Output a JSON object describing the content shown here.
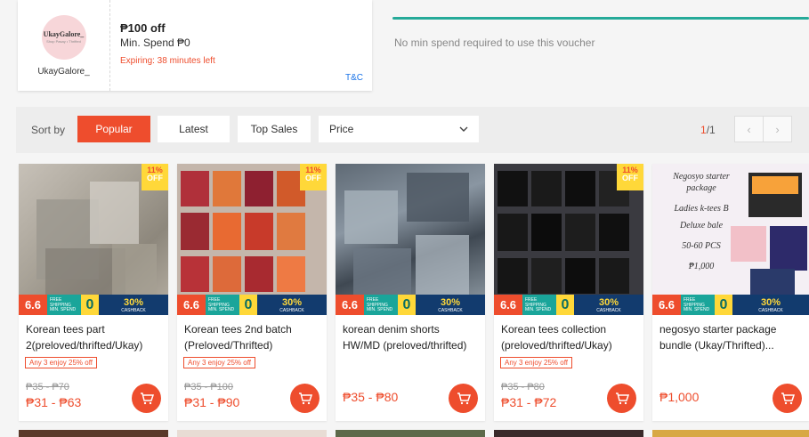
{
  "voucher": {
    "shop_logo_text": "UkayGalore_",
    "shop_logo_sub": "Shop Pasay • Thrifted",
    "shop_name": "UkayGalore_",
    "title": "₱100 off",
    "min_spend": "Min. Spend ₱0",
    "expiry": "Expiring: 38 minutes left",
    "tc": "T&C"
  },
  "voucher2": {
    "text": "No min spend required to use this voucher"
  },
  "sort": {
    "label": "Sort by",
    "popular": "Popular",
    "latest": "Latest",
    "top_sales": "Top Sales",
    "price": "Price",
    "page_current": "1",
    "page_total": "/1"
  },
  "promo": {
    "sale": "6.6",
    "free_shipping": "FREE SHIPPING",
    "min_spend_note": "MIN. SPEND",
    "zero": "0",
    "cashback_pct": "30%",
    "cashback": "CASHBACK"
  },
  "products": [
    {
      "title": "Korean tees part 2(preloved/thrifted/Ukay)",
      "discount": "11%",
      "off": "OFF",
      "badge": "Any 3 enjoy 25% off",
      "original_price": "₱35 - ₱70",
      "price": "₱31 - ₱63"
    },
    {
      "title": "Korean tees 2nd batch (Preloved/Thrifted)",
      "discount": "11%",
      "off": "OFF",
      "badge": "Any 3 enjoy 25% off",
      "original_price": "₱35 - ₱100",
      "price": "₱31 - ₱90"
    },
    {
      "title": "korean denim shorts HW/MD (preloved/thrifted)",
      "price": "₱35 - ₱80"
    },
    {
      "title": "Korean tees collection (preloved/thrifted/Ukay)",
      "discount": "11%",
      "off": "OFF",
      "badge": "Any 3 enjoy 25% off",
      "original_price": "₱35 - ₱80",
      "price": "₱31 - ₱72"
    },
    {
      "title": "negosyo starter package bundle (Ukay/Thrifted)...",
      "price": "₱1,000",
      "image_text": {
        "line1": "Negosyo starter",
        "line2": "package",
        "line3": "Ladies k-tees B",
        "line4": "Deluxe bale",
        "line5": "50-60 PCS",
        "line6": "₱1,000"
      }
    }
  ],
  "colors": {
    "accent": "#ee4d2d",
    "teal": "#26aa99"
  }
}
